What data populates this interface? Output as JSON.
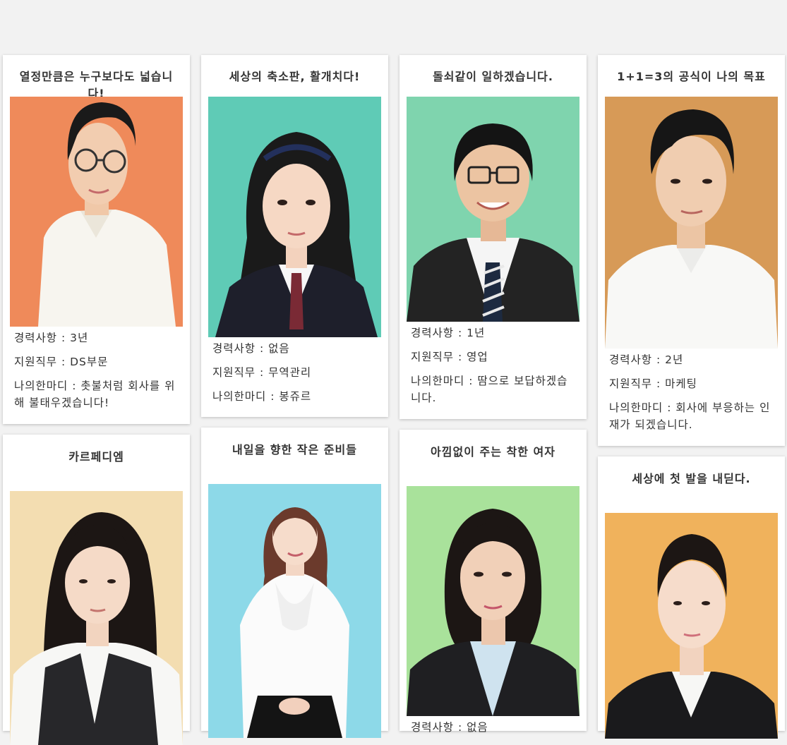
{
  "label_career": "경력사항 : ",
  "label_role": "지원직무 : ",
  "label_word": "나의한마디 : ",
  "cards": [
    {
      "title": "열정만큼은 누구보다도 넓습니다!",
      "career": "3년",
      "role": "DS부문",
      "word": "촛불처럼 회사를 위해 불태우겠습니다!",
      "bg": "#ef8a5a"
    },
    {
      "title": "세상의 축소판, 활개치다!",
      "career": "없음",
      "role": "무역관리",
      "word": "봉쥬르",
      "bg": "#5fcbb6"
    },
    {
      "title": "돌쇠같이 일하겠습니다.",
      "career": "1년",
      "role": "영업",
      "word": "땀으로 보답하겠습니다.",
      "bg": "#7fd4ae"
    },
    {
      "title": "1+1=3의 공식이 나의 목표",
      "career": "2년",
      "role": "마케팅",
      "word": "회사에 부응하는 인재가 되겠습니다.",
      "bg": "#d79a57"
    },
    {
      "title": "카르페디엠",
      "bg": "#f3ddb1"
    },
    {
      "title": "내일을 향한 작은 준비들",
      "bg": "#8dd9e8"
    },
    {
      "title": "아낌없이 주는 착한 여자",
      "career": "없음",
      "bg": "#a9e29b"
    },
    {
      "title": "세상에 첫 발을 내딛다.",
      "bg": "#f0b25c"
    }
  ]
}
